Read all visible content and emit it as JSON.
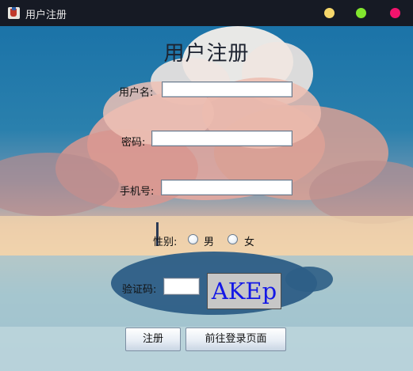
{
  "window": {
    "title": "用户注册",
    "controls": {
      "minimize_color": "#f6d76b",
      "maximize_color": "#82e62e",
      "close_color": "#f2146d"
    }
  },
  "form": {
    "heading": "用户注册",
    "username_label": "用户名:",
    "username_value": "",
    "password_label": "密码:",
    "password_value": "",
    "phone_label": "手机号:",
    "phone_value": "",
    "gender_label": "性别:",
    "gender_options": [
      "男",
      "女"
    ],
    "captcha_label": "验证码:",
    "captcha_value": "",
    "captcha_text": "AKEp",
    "register_button": "注册",
    "goto_login_button": "前往登录页面"
  }
}
